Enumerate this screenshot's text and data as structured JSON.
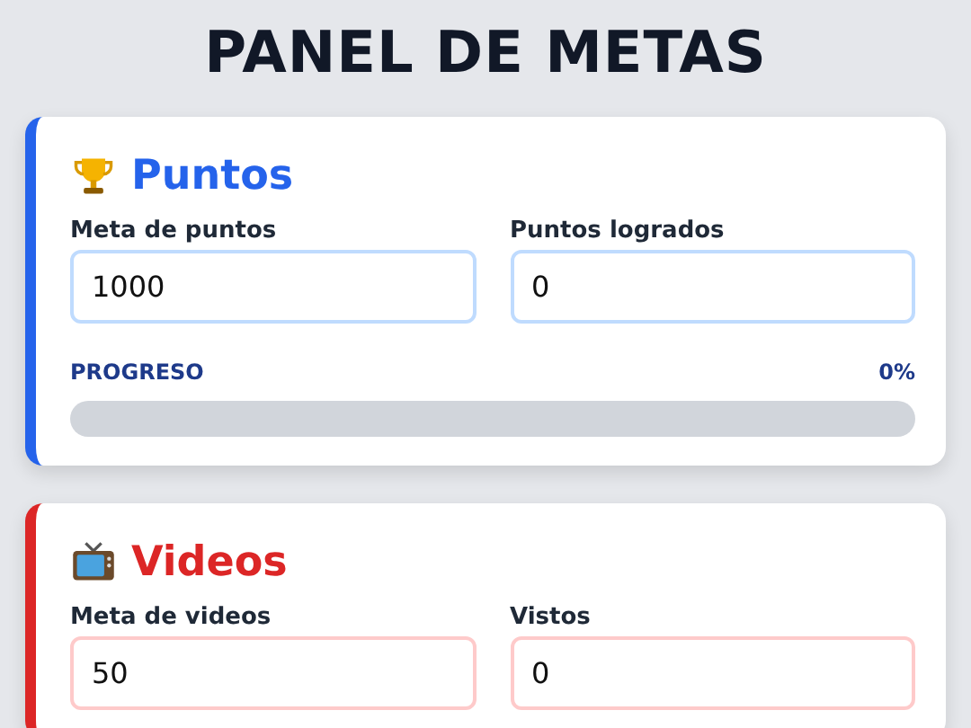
{
  "title": "PANEL DE METAS",
  "cards": [
    {
      "kind": "trophy",
      "title": "Puntos",
      "color": "#2563eb",
      "fields": [
        {
          "label": "Meta de puntos",
          "value": "1000"
        },
        {
          "label": "Puntos logrados",
          "value": "0"
        }
      ],
      "progress": {
        "label": "PROGRESO",
        "reading": "0%",
        "level": 0
      }
    },
    {
      "kind": "tv",
      "title": "Videos",
      "color": "#dc2626",
      "fields": [
        {
          "label": "Meta de videos",
          "value": "50"
        },
        {
          "label": "Vistos",
          "value": "0"
        }
      ]
    }
  ]
}
